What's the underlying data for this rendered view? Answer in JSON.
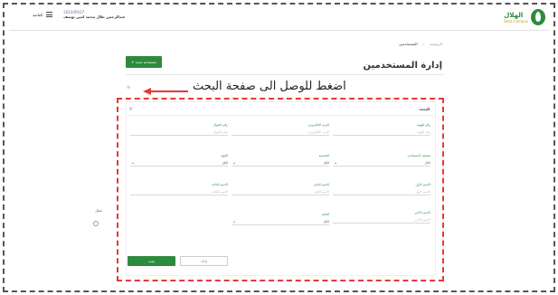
{
  "header": {
    "logo_main": "الهلال",
    "logo_sub": "Beta Campus",
    "menu_label": "القائمة",
    "date": "2023/09/27",
    "user_name": "عبدالرحمن جلال محمد امين يوسف"
  },
  "breadcrumb": [
    "الرئيسية",
    "المستخدمين"
  ],
  "page_title": "إدارة المستخدمين",
  "add_button": "+ مستخدم جديد",
  "annotation": "اضغط للوصل الى صفحة البحث",
  "colors": {
    "brand": "#2e8b3e",
    "annotation": "#e53935"
  },
  "form": {
    "title": "البحث",
    "close": "×",
    "fields": {
      "id_number": {
        "label": "رقم الهوية",
        "placeholder": "رقم الهوية"
      },
      "email": {
        "label": "البريد الإلكتروني",
        "placeholder": "البريد الإلكتروني"
      },
      "mobile": {
        "label": "رقم الجوال",
        "placeholder": "رقم الجوال"
      },
      "user_type": {
        "label": "تصنيف المستخدم",
        "value": "الكل"
      },
      "nationality": {
        "label": "الجنسية",
        "value": "الكل"
      },
      "entity": {
        "label": "الجهة",
        "value": "الكل"
      },
      "first_name": {
        "label": "الاسم الأول",
        "placeholder": "الاسم الأول"
      },
      "second_name": {
        "label": "الاسم الثاني",
        "placeholder": "الاسم الثاني"
      },
      "third_name": {
        "label": "الاسم الثالث",
        "placeholder": "الاسم الثالث"
      },
      "last_name": {
        "label": "الاسم الأخير",
        "placeholder": "الاسم الأخير"
      },
      "status": {
        "label": "الحالة",
        "value": "الكل"
      }
    },
    "checkbox_label": "مُفعّل",
    "save": "بحث",
    "cancel": "إلغاء"
  }
}
